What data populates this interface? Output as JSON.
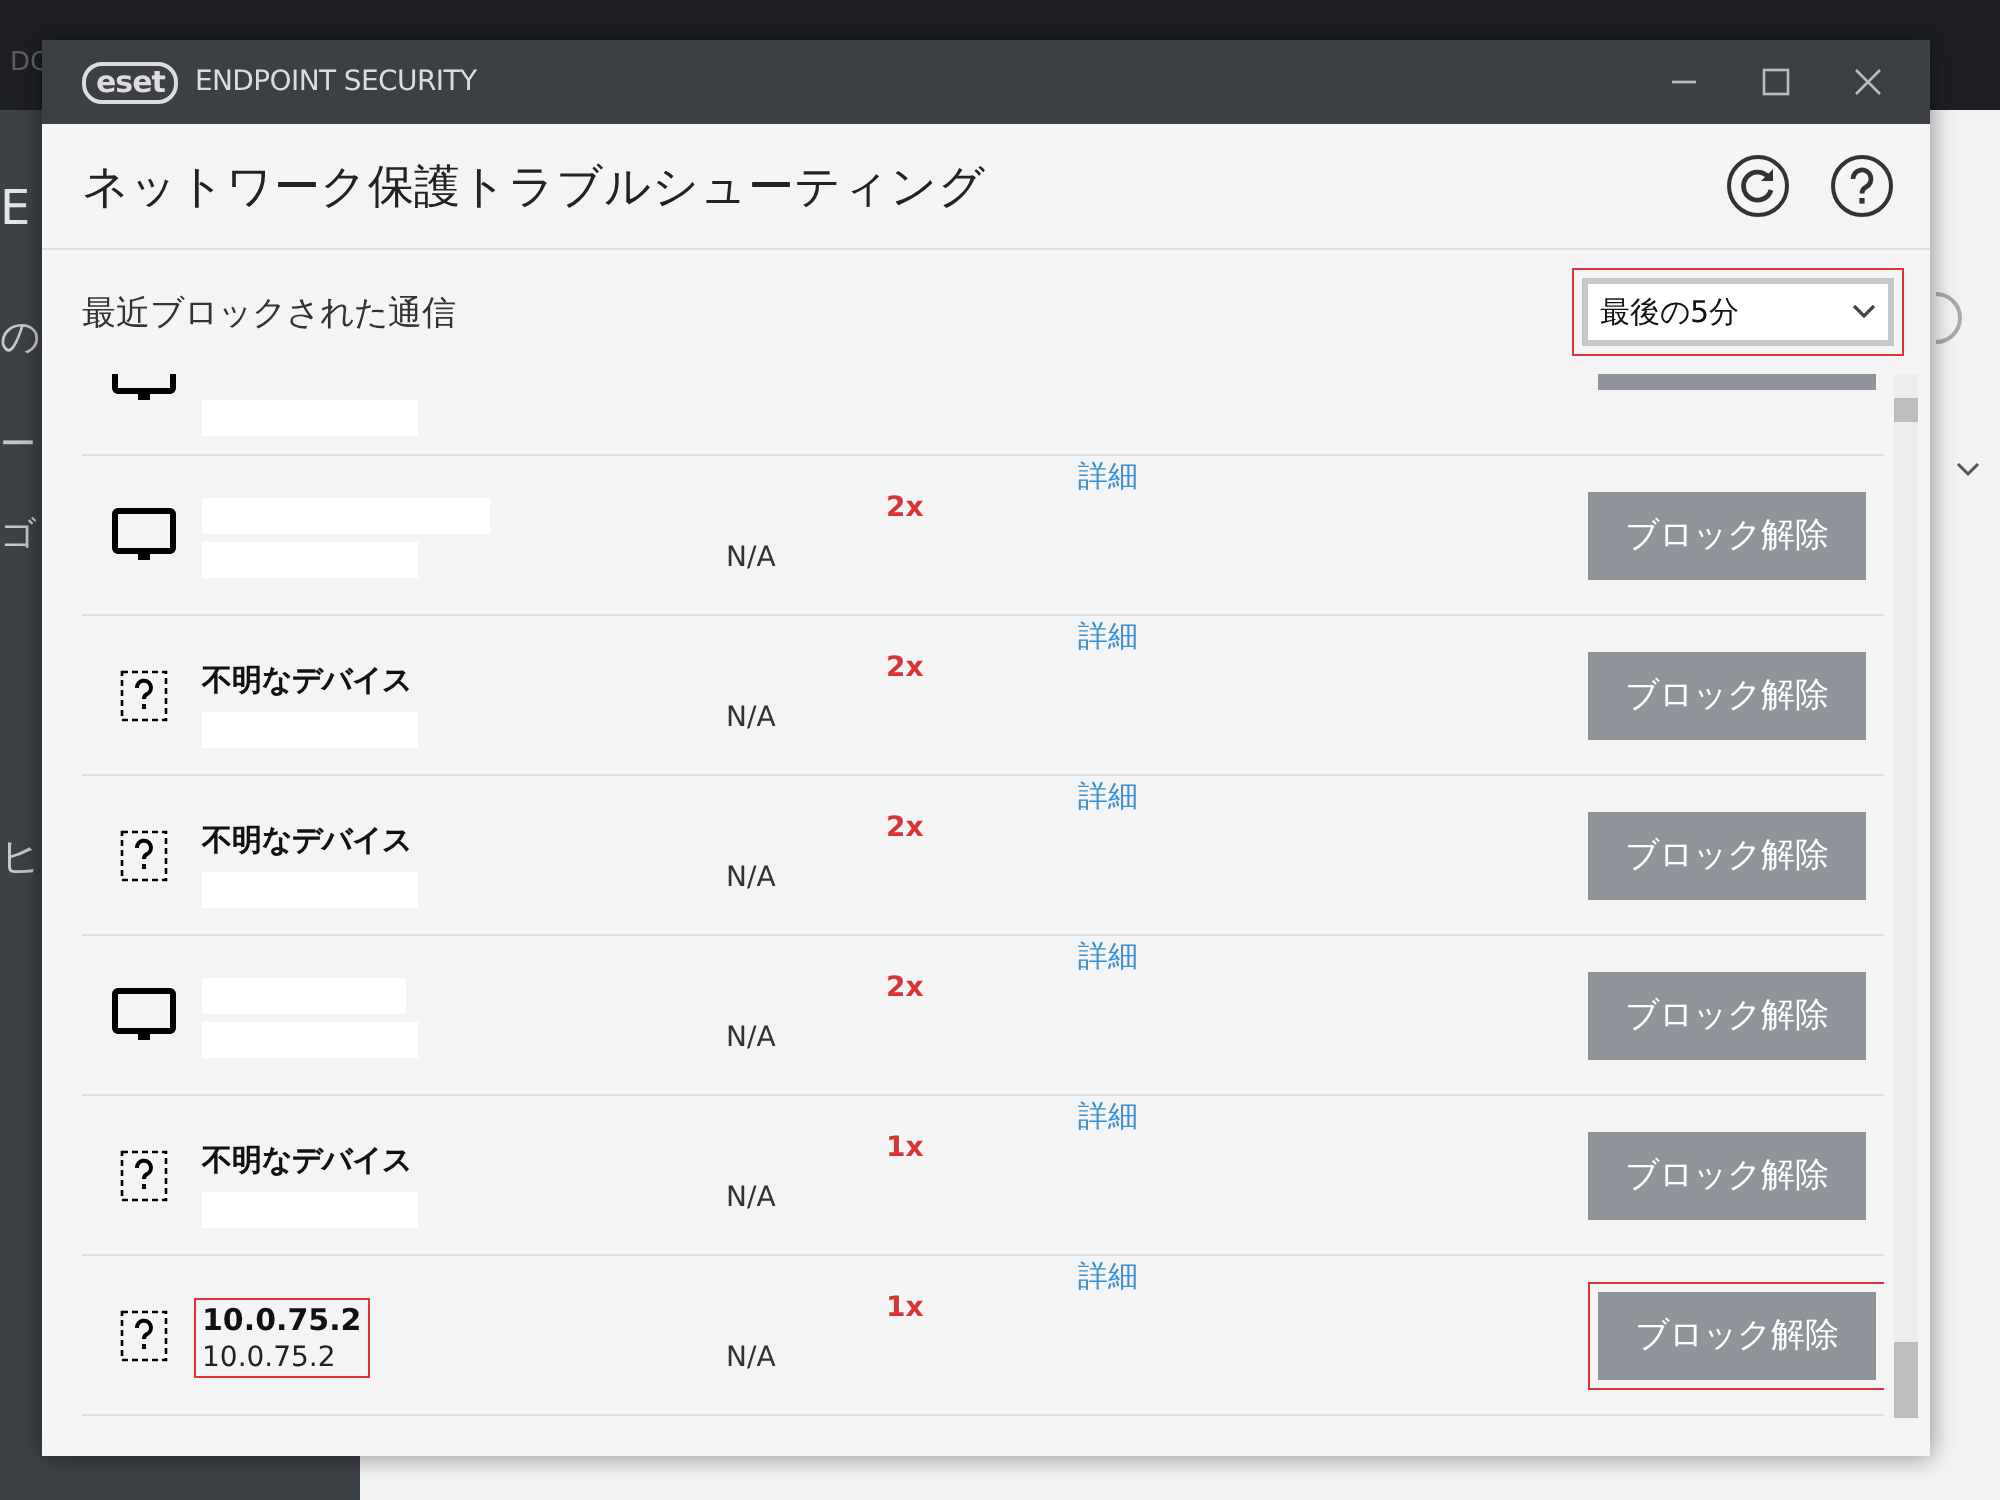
{
  "background_app": {
    "fragments": [
      "DC",
      "E",
      "の",
      "ー",
      "ゴ",
      "ヒ"
    ]
  },
  "window": {
    "brand": "eset",
    "title": "ENDPOINT SECURITY"
  },
  "header": {
    "title": "ネットワーク保護トラブルシューティング"
  },
  "section": {
    "title": "最近ブロックされた通信",
    "period": {
      "value": "最後の5分",
      "highlighted": true
    }
  },
  "rows": [
    {
      "kind": "monitor",
      "cut_off": true,
      "name_redacted": false,
      "address_redacted": true
    },
    {
      "kind": "monitor",
      "cut_off": false,
      "name_redacted": true,
      "address_redacted": true,
      "status": "N/A",
      "count": "2x",
      "link": "詳細",
      "button": "ブロック解除",
      "highlighted": false
    },
    {
      "kind": "unknown",
      "cut_off": false,
      "name": "不明なデバイス",
      "name_redacted": false,
      "address_redacted": true,
      "status": "N/A",
      "count": "2x",
      "link": "詳細",
      "button": "ブロック解除",
      "highlighted": false
    },
    {
      "kind": "unknown",
      "cut_off": false,
      "name": "不明なデバイス",
      "name_redacted": false,
      "address_redacted": true,
      "status": "N/A",
      "count": "2x",
      "link": "詳細",
      "button": "ブロック解除",
      "highlighted": false
    },
    {
      "kind": "monitor",
      "cut_off": false,
      "name_redacted": true,
      "address_redacted": true,
      "status": "N/A",
      "count": "2x",
      "link": "詳細",
      "button": "ブロック解除",
      "highlighted": false
    },
    {
      "kind": "unknown",
      "cut_off": false,
      "name": "不明なデバイス",
      "name_redacted": false,
      "address_redacted": true,
      "status": "N/A",
      "count": "1x",
      "link": "詳細",
      "button": "ブロック解除",
      "highlighted": false
    },
    {
      "kind": "unknown",
      "cut_off": false,
      "name": "10.0.75.2",
      "address": "10.0.75.2",
      "name_redacted": false,
      "address_redacted": false,
      "status": "N/A",
      "count": "1x",
      "link": "詳細",
      "button": "ブロック解除",
      "highlighted": true
    }
  ]
}
